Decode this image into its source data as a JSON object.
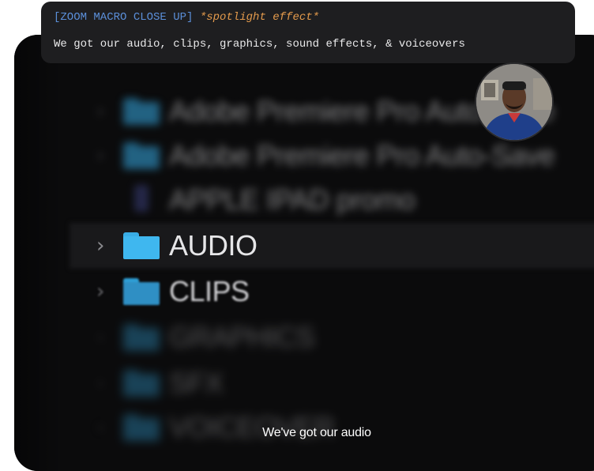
{
  "banner": {
    "shot_label": "[ZOOM MACRO CLOSE UP]",
    "effect_label": "*spotlight effect*",
    "script_line": "We got our audio, clips, graphics, sound effects, & voiceovers"
  },
  "finder": {
    "rows": [
      {
        "name": "Adobe Premiere Pro Auto-Save",
        "state": "blurred"
      },
      {
        "name": "Adobe Premiere Pro Auto-Save",
        "state": "blurred"
      },
      {
        "name": "APPLE IPAD promo",
        "state": "blurred"
      },
      {
        "name": "AUDIO",
        "state": "selected"
      },
      {
        "name": "CLIPS",
        "state": "soft"
      },
      {
        "name": "GRAPHICS",
        "state": "blurred"
      },
      {
        "name": "SFX",
        "state": "blurred"
      },
      {
        "name": "VOICEOVER",
        "state": "blurred"
      }
    ],
    "folder_color": "#35a9e3"
  },
  "caption": {
    "text": "We've got our audio"
  },
  "colors": {
    "background": "#0b0b0c",
    "banner_bg": "#1e1e20",
    "shot_label": "#5b8fd9",
    "effect_label": "#e39a4c"
  }
}
